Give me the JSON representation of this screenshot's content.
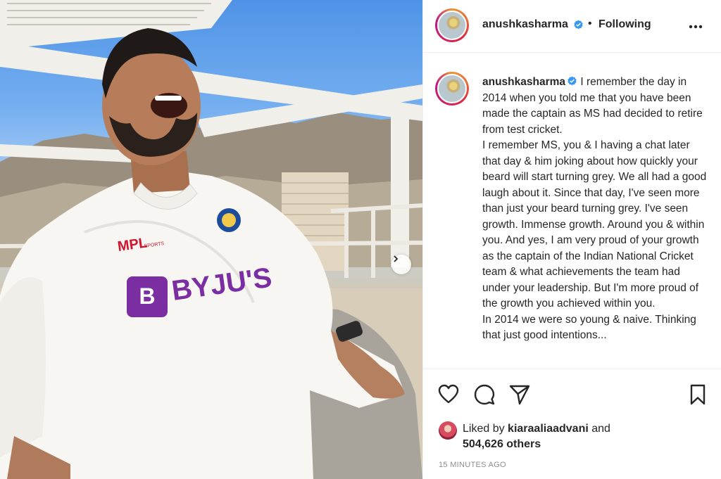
{
  "post": {
    "username": "anushkasharma",
    "following_label": "Following",
    "separator": "•",
    "caption": "I remember the day in 2014 when you told me that you have been made the captain as MS had decided to retire from test cricket.\nI remember MS, you & I having a chat later that day & him joking about how quickly your beard will start turning grey. We all had a good laugh about it. Since that day, I've seen more than just your beard turning grey. I've seen growth. Immense growth. Around you & within you. And yes, I am very proud of your growth as the captain of the Indian National Cricket team & what achievements the team had under your leadership. But I'm more proud of the growth you achieved within you.\nIn 2014 we were so young & naive. Thinking that just good intentions...",
    "likes": {
      "prefix": "Liked by",
      "user": "kiaraaliaadvani",
      "conj": "and",
      "others": "504,626 others"
    },
    "timestamp": "15 MINUTES AGO"
  },
  "photo": {
    "jersey_sponsor": "BYJU'S",
    "kit_brand": "MPL",
    "kit_brand_sub": "SPORTS"
  },
  "icons": {
    "verified": "verified-badge-icon",
    "more": "more-options-icon",
    "like": "heart-icon",
    "comment": "comment-icon",
    "share": "paper-plane-icon",
    "save": "bookmark-icon",
    "next": "chevron-right-icon"
  },
  "colors": {
    "verified_blue": "#3897f0",
    "text": "#262626",
    "muted": "#8e8e8e",
    "border": "#efefef"
  }
}
